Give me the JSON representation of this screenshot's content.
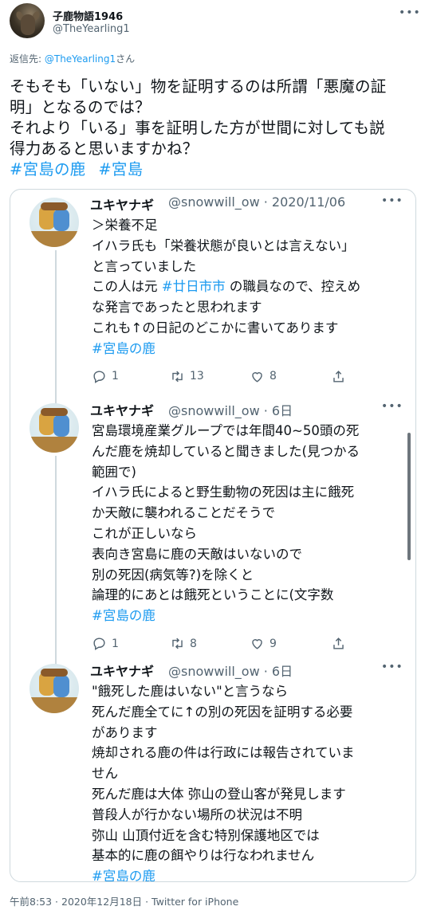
{
  "main_tweet": {
    "display_name": "子鹿物語1946",
    "handle": "@TheYearling1",
    "reply_prefix": "返信先: ",
    "reply_mention": "@TheYearling1",
    "reply_suffix": "さん",
    "text_lines": [
      "そもそも「いない」物を証明するのは所謂「悪魔の証",
      "明」となるのでは？",
      "それより「いる」事を証明した方が世間に対しても説",
      "得力あると思いますかね？"
    ],
    "hashtags": [
      "#宮島の鹿",
      "#宮島"
    ],
    "more_icon": "ellipsis-icon",
    "timestamp": "午前8:53 · 2020年12月18日 · Twitter for iPhone"
  },
  "quoted_thread": [
    {
      "name": "ユキヤナギ",
      "handle_date": "@snowwill_ow · 2020/11/06",
      "lines": [
        [
          {
            "t": "＞栄養不足"
          }
        ],
        [
          {
            "t": "イハラ氏も「栄養状態が良いとは言えない」"
          }
        ],
        [
          {
            "t": "と言っていました"
          }
        ],
        [
          {
            "t": "この人は元 "
          },
          {
            "t": "#廿日市市",
            "link": true
          },
          {
            "t": " の職員なので、控えめ"
          }
        ],
        [
          {
            "t": "な発言であったと思われます"
          }
        ],
        [
          {
            "t": "これも↑の日記のどこかに書いてあります"
          }
        ],
        [
          {
            "t": "#宮島の鹿",
            "link": true
          }
        ]
      ],
      "replies": "1",
      "retweets": "13",
      "likes": "8"
    },
    {
      "name": "ユキヤナギ",
      "handle_date": "@snowwill_ow · 6日",
      "lines": [
        [
          {
            "t": "宮島環境産業グループでは年間40~50頭の死"
          }
        ],
        [
          {
            "t": "んだ鹿を焼却していると聞きました(見つかる"
          }
        ],
        [
          {
            "t": "範囲で)"
          }
        ],
        [
          {
            "t": "イハラ氏によると野生動物の死因は主に餓死"
          }
        ],
        [
          {
            "t": "か天敵に襲われることだそうで"
          }
        ],
        [
          {
            "t": "これが正しいなら"
          }
        ],
        [
          {
            "t": "表向き宮島に鹿の天敵はいないので"
          }
        ],
        [
          {
            "t": "別の死因(病気等?)を除くと"
          }
        ],
        [
          {
            "t": "論理的にあとは餓死ということに(文字数"
          }
        ],
        [
          {
            "t": "#宮島の鹿",
            "link": true
          }
        ]
      ],
      "replies": "1",
      "retweets": "8",
      "likes": "9"
    },
    {
      "name": "ユキヤナギ",
      "handle_date": "@snowwill_ow · 6日",
      "lines": [
        [
          {
            "t": "\"餓死した鹿はいない\"と言うなら"
          }
        ],
        [
          {
            "t": "死んだ鹿全てに↑の別の死因を証明する必要"
          }
        ],
        [
          {
            "t": "があります"
          }
        ],
        [
          {
            "t": "焼却される鹿の件は行政には報告されていま"
          }
        ],
        [
          {
            "t": "せん"
          }
        ],
        [
          {
            "t": "死んだ鹿は大体 弥山の登山客が発見します"
          }
        ],
        [
          {
            "t": "普段人が行かない場所の状況は不明"
          }
        ],
        [
          {
            "t": "弥山 山頂付近を含む特別保護地区では"
          }
        ],
        [
          {
            "t": "基本的に鹿の餌やりは行なわれません"
          }
        ],
        [
          {
            "t": "#宮島の鹿",
            "link": true
          }
        ]
      ]
    }
  ],
  "colors": {
    "link": "#1d9bf0",
    "secondary_text": "#536471",
    "border": "#cfd9de"
  }
}
